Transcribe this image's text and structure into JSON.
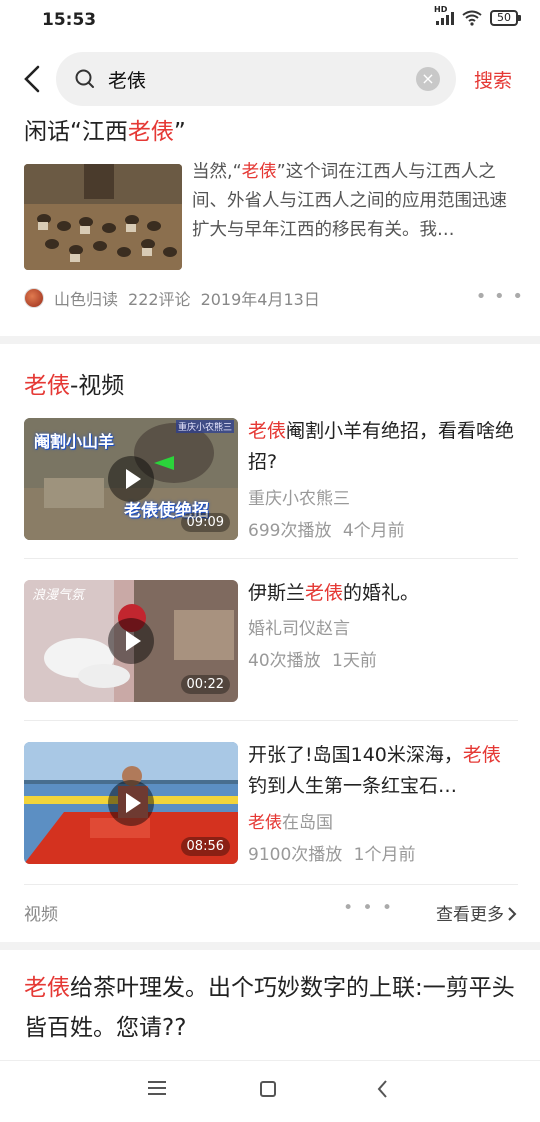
{
  "status": {
    "time": "15:53",
    "battery": "50",
    "hd": "HD"
  },
  "search": {
    "query": "老俵",
    "button": "搜索"
  },
  "article": {
    "title_prefix": "闲话“江西",
    "title_highlight": "老俵",
    "title_suffix": "”",
    "desc_prefix": "当然,“",
    "desc_highlight": "老俵",
    "desc_suffix": "”这个词在江西人与江西人之间、外省人与江西人之间的应用范围迅速扩大与早年江西的移民有关。我…",
    "source": "山色归读",
    "comments": "222评论",
    "date": "2019年4月13日"
  },
  "video_section": {
    "title_highlight": "老俵",
    "title_suffix": "-视频",
    "items": [
      {
        "title_highlight": "老俵",
        "title_rest": "阉割小羊有绝招，看看啥绝招?",
        "author": "重庆小农熊三",
        "author_highlight": "",
        "plays": "699次播放",
        "time": "4个月前",
        "duration": "09:09",
        "thumb_text_1": "阉割小山羊",
        "thumb_text_2": "老俵使绝招",
        "thumb_tag": "重庆小农熊三"
      },
      {
        "title_pre": "伊斯兰",
        "title_highlight": "老俵",
        "title_rest": "的婚礼。",
        "author": "婚礼司仪赵言",
        "author_highlight": "",
        "plays": "40次播放",
        "time": "1天前",
        "duration": "00:22",
        "thumb_text_1": "浪漫气氛"
      },
      {
        "title_pre": "开张了!岛国140米深海，",
        "title_highlight": "老俵",
        "title_rest": "钓到人生第一条红宝石…",
        "author_highlight": "老俵",
        "author": "在岛国",
        "plays": "9100次播放",
        "time": "1个月前",
        "duration": "08:56"
      }
    ],
    "footer_label": "视频",
    "footer_more": "查看更多"
  },
  "bottom_article": {
    "highlight": "老俵",
    "text": "给茶叶理发。出个巧妙数字的上联:一剪平头皆百姓。您请??"
  }
}
